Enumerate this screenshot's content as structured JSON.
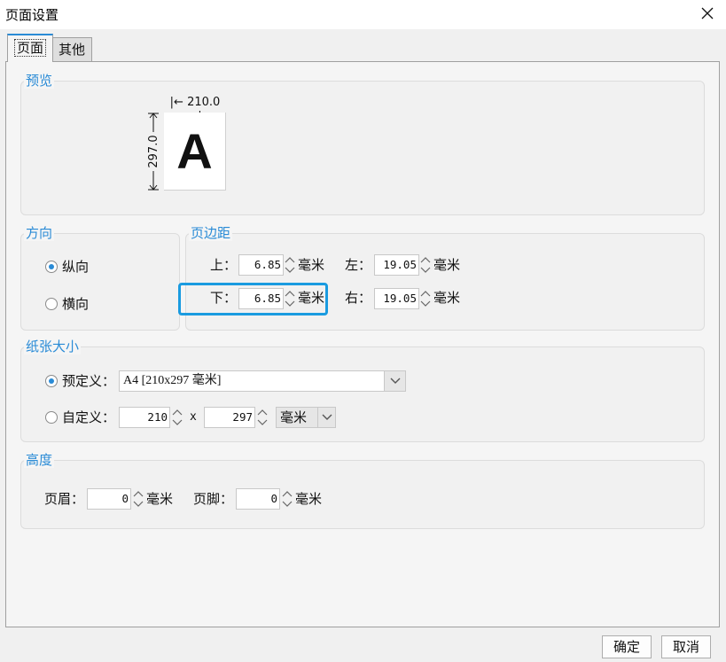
{
  "window": {
    "title": "页面设置"
  },
  "tabs": [
    {
      "label": "页面",
      "active": true
    },
    {
      "label": "其他",
      "active": false
    }
  ],
  "preview": {
    "legend": "预览",
    "width_label": "210.0",
    "height_label": "297.0",
    "page_letter": "A"
  },
  "orientation": {
    "legend": "方向",
    "portrait_label": "纵向",
    "landscape_label": "横向",
    "selected": "portrait"
  },
  "margins": {
    "legend": "页边距",
    "top_label": "上：",
    "top_value": "6.85",
    "left_label": "左：",
    "left_value": "19.05",
    "bottom_label": "下：",
    "bottom_value": "6.85",
    "right_label": "右：",
    "right_value": "19.05",
    "unit": "毫米"
  },
  "paper": {
    "legend": "纸张大小",
    "predefined_label": "预定义：",
    "predefined_value": "A4 [210x297 毫米]",
    "custom_label": "自定义：",
    "custom_width": "210",
    "custom_x": "x",
    "custom_height": "297",
    "custom_unit": "毫米",
    "selected": "predefined"
  },
  "height": {
    "legend": "高度",
    "header_label": "页眉：",
    "header_value": "0",
    "footer_label": "页脚：",
    "footer_value": "0",
    "unit": "毫米"
  },
  "buttons": {
    "ok": "确定",
    "cancel": "取消"
  },
  "colors": {
    "accent": "#2a8bd6",
    "highlight": "#1a9be0"
  }
}
